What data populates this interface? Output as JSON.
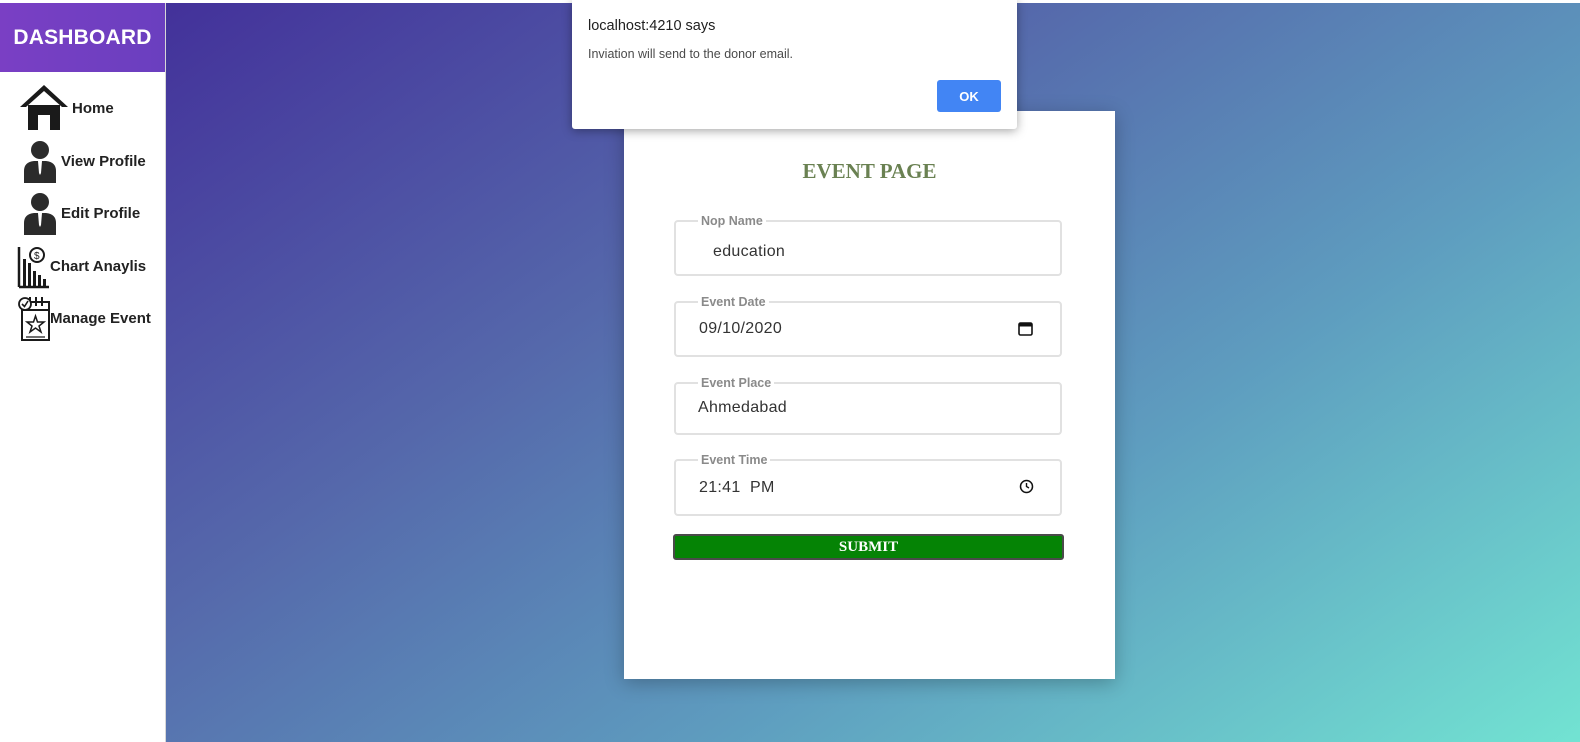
{
  "sidebar": {
    "title": "DASHBOARD",
    "items": [
      {
        "label": "Home",
        "icon": "home-icon"
      },
      {
        "label": "View Profile",
        "icon": "user-icon"
      },
      {
        "label": "Edit Profile",
        "icon": "user-icon"
      },
      {
        "label": "Chart Anaylis",
        "icon": "chart-icon"
      },
      {
        "label": "Manage Event",
        "icon": "calendar-star-icon"
      }
    ]
  },
  "form": {
    "title": "EVENT PAGE",
    "nop_name": {
      "label": "Nop Name",
      "value": "education"
    },
    "event_date": {
      "label": "Event Date",
      "value": "09/10/2020"
    },
    "event_place": {
      "label": "Event Place",
      "value": "Ahmedabad"
    },
    "event_time": {
      "label": "Event Time",
      "value": "21:41  PM"
    },
    "submit_label": "SUBMIT"
  },
  "dialog": {
    "title": "localhost:4210 says",
    "message": "Inviation will send to the donor email.",
    "ok_label": "OK"
  },
  "colors": {
    "sidebar_header": "#6a3fbf",
    "submit": "#058305",
    "ok_button": "#4285f4",
    "title": "#6a8152"
  }
}
